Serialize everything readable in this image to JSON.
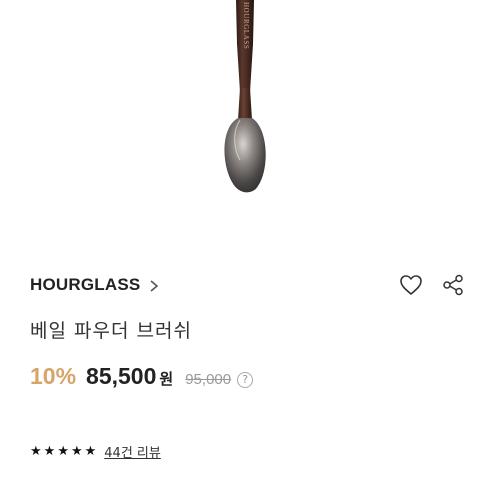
{
  "product": {
    "brush_imprint": "HOURGLASS",
    "brand": "HOURGLASS",
    "name": "베일 파우더 브러쉬",
    "discount": "10%",
    "sale_price": "85,500",
    "currency": "원",
    "original_price": "95,000",
    "info_glyph": "?"
  },
  "rating": {
    "stars": 5,
    "star_glyph": "★",
    "review_link": "44건 리뷰"
  },
  "icons": {
    "brand_arrow": "chevron-right-icon",
    "wishlist": "heart-icon",
    "share": "share-icon",
    "info": "info-icon",
    "star": "star-icon"
  },
  "colors": {
    "discount": "#d7a46a",
    "brush_handle": "#4a2c24",
    "brush_bristles": "#3b3838"
  }
}
